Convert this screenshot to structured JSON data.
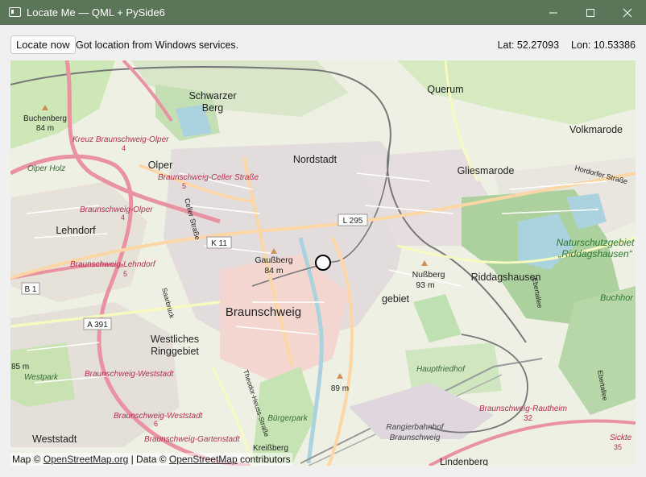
{
  "window": {
    "title": "Locate Me — QML + PySide6"
  },
  "toolbar": {
    "locate_label": "Locate now",
    "status_text": "Got location from Windows services.",
    "lat_text": "Lat: 52.27093",
    "lon_text": "Lon: 10.53386"
  },
  "map": {
    "attribution": {
      "prefix": "Map © ",
      "link1": "OpenStreetMap.org",
      "middle": " | Data © ",
      "link2": "OpenStreetMap",
      "suffix": " contributors"
    },
    "labels": {
      "quarum": "Querum",
      "schwarzer_berg_1": "Schwarzer",
      "schwarzer_berg_2": "Berg",
      "buchenberg": "Buchenberg",
      "buchenberg_elev": "84 m",
      "volkmarode": "Volkmarode",
      "kreuz_olper": "Kreuz Braunschweig-Olper",
      "nordstadt": "Nordstadt",
      "olper": "Olper",
      "olper_holz": "Olper Holz",
      "celler_strasse": "Braunschweig-Celler Straße",
      "gliesmarode": "Gliesmarode",
      "hordorfer": "Hordorfer Straße",
      "celler_strasse_v": "Celler Straße",
      "bs_olper": "Braunschweig-Olper",
      "l295": "L 295",
      "naturschutz_1": "Naturschutzgebiet",
      "naturschutz_2": "„Riddagshausen“",
      "lehndorf": "Lehndorf",
      "k11": "K 11",
      "gaussberg": "Gaußberg",
      "gaussberg_elev": "84 m",
      "bs_lehndorf": "Braunschweig-Lehndorf",
      "nussberg": "Nußberg",
      "nussberg_elev": "93 m",
      "riddagshausen": "Riddagshausen",
      "b1": "B 1",
      "ebertallee": "Ebertallee",
      "buchhorst": "Buchhor",
      "gebiet": "gebiet",
      "saarbrueck": "Saarbrück",
      "braunschweig": "Braunschweig",
      "a391": "A 391",
      "westliches_1": "Westliches",
      "westliches_2": "Ringgebiet",
      "hauptfriedhof": "Hauptfriedhof",
      "elev_85": "85 m",
      "westpark": "Westpark",
      "bs_weststadt": "Braunschweig-Weststadt",
      "theodor_heuss": "Theodor-Heuss-Straße",
      "elev_89": "89 m",
      "ebertallee2": "Ebertallee",
      "bs_weststadt2": "Braunschweig-Weststadt",
      "bs_rautheim": "Braunschweig-Rautheim",
      "rautheim_num": "32",
      "rangierbahnhof_1": "Rangierbahnhof",
      "rangierbahnhof_2": "Braunschweig",
      "bs_gartenstadt": "Braunschweig-Gartenstadt",
      "buergerpark": "Bürgerpark",
      "weststadt": "Weststadt",
      "kreissberg": "Kreißberg",
      "sickte": "Sickte",
      "lindenberg": "Lindenberg",
      "num4a": "4",
      "num5a": "5",
      "num4b": "4",
      "num5b": "5",
      "num6": "6",
      "num35": "35"
    }
  },
  "colors": {
    "titlebar": "#5b7559",
    "motorway": "#e892a2",
    "primary": "#fcd6a4",
    "forest": "#add19e",
    "water": "#aad3df",
    "residential": "#e0dfdf",
    "marker": "#ffffff"
  }
}
